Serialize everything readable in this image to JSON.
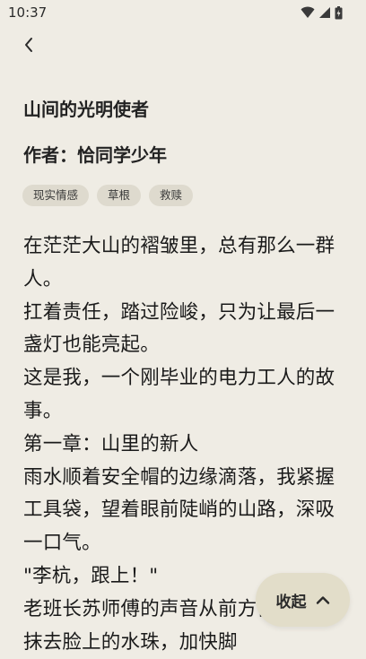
{
  "status_bar": {
    "time": "10:37",
    "icons": [
      "wifi-icon",
      "signal-icon",
      "battery-icon"
    ]
  },
  "nav": {
    "back_icon": "chevron-left-icon"
  },
  "book": {
    "title": "山间的光明使者",
    "author": "作者：恰同学少年",
    "tags": [
      "现实情感",
      "草根",
      "救赎"
    ]
  },
  "content": {
    "paragraphs": [
      "在茫茫大山的褶皱里，总有那么一群人。",
      "扛着责任，踏过险峻，只为让最后一盏灯也能亮起。",
      "这是我，一个刚毕业的电力工人的故事。",
      "第一章：山里的新人",
      "雨水顺着安全帽的边缘滴落，我紧握工具袋，望着眼前陡峭的山路，深吸一口气。",
      "\"李杭，跟上！\"",
      "老班长苏师傅的声音从前方传来。我抹去脸上的水珠，加快脚"
    ]
  },
  "collapse_button": {
    "label": "收起",
    "icon": "chevron-up-icon"
  },
  "colors": {
    "background": "#efece4",
    "tag_background": "#dedace",
    "button_background": "#e2ddc9"
  }
}
